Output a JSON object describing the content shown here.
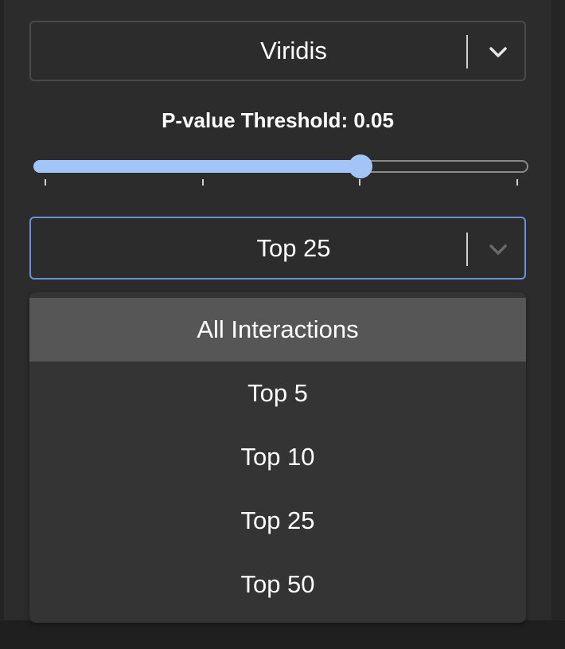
{
  "colormap_select": {
    "value": "Viridis"
  },
  "threshold": {
    "label": "P-value Threshold: 0.05",
    "slider_fraction": 0.66,
    "tick_count": 4
  },
  "top_select": {
    "value": "Top 25",
    "options": [
      "All Interactions",
      "Top 5",
      "Top 10",
      "Top 25",
      "Top 50"
    ],
    "highlighted_index": 0
  },
  "colors": {
    "accent": "#a3c4f7",
    "focus_border": "#6b8fd8",
    "highlight": "#565656"
  },
  "icons": {
    "dropdown_chevron": "chevron-down-icon"
  }
}
